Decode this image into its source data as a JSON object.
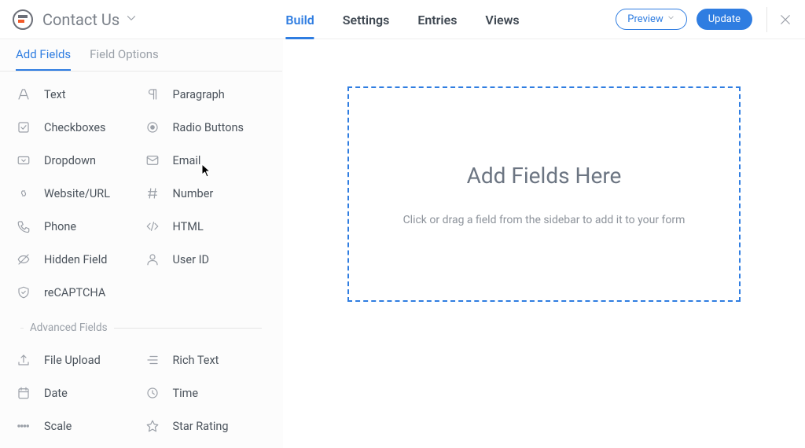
{
  "header": {
    "formTitle": "Contact Us",
    "tabs": {
      "build": "Build",
      "settings": "Settings",
      "entries": "Entries",
      "views": "Views"
    },
    "previewLabel": "Preview",
    "updateLabel": "Update"
  },
  "sidebar": {
    "tabs": {
      "addFields": "Add Fields",
      "fieldOptions": "Field Options"
    },
    "basicFields": [
      {
        "label": "Text",
        "icon": "text-icon"
      },
      {
        "label": "Paragraph",
        "icon": "paragraph-icon"
      },
      {
        "label": "Checkboxes",
        "icon": "checkbox-icon"
      },
      {
        "label": "Radio Buttons",
        "icon": "radio-icon"
      },
      {
        "label": "Dropdown",
        "icon": "dropdown-icon"
      },
      {
        "label": "Email",
        "icon": "email-icon"
      },
      {
        "label": "Website/URL",
        "icon": "link-icon"
      },
      {
        "label": "Number",
        "icon": "hash-icon"
      },
      {
        "label": "Phone",
        "icon": "phone-icon"
      },
      {
        "label": "HTML",
        "icon": "code-icon"
      },
      {
        "label": "Hidden Field",
        "icon": "hidden-icon"
      },
      {
        "label": "User ID",
        "icon": "user-icon"
      },
      {
        "label": "reCAPTCHA",
        "icon": "shield-icon"
      }
    ],
    "advancedHeader": "Advanced Fields",
    "advancedFields": [
      {
        "label": "File Upload",
        "icon": "upload-icon"
      },
      {
        "label": "Rich Text",
        "icon": "richtext-icon"
      },
      {
        "label": "Date",
        "icon": "calendar-icon"
      },
      {
        "label": "Time",
        "icon": "clock-icon"
      },
      {
        "label": "Scale",
        "icon": "scale-icon"
      },
      {
        "label": "Star Rating",
        "icon": "star-icon"
      }
    ]
  },
  "canvas": {
    "heading": "Add Fields Here",
    "subtext": "Click or drag a field from the sidebar to add it to your form"
  }
}
